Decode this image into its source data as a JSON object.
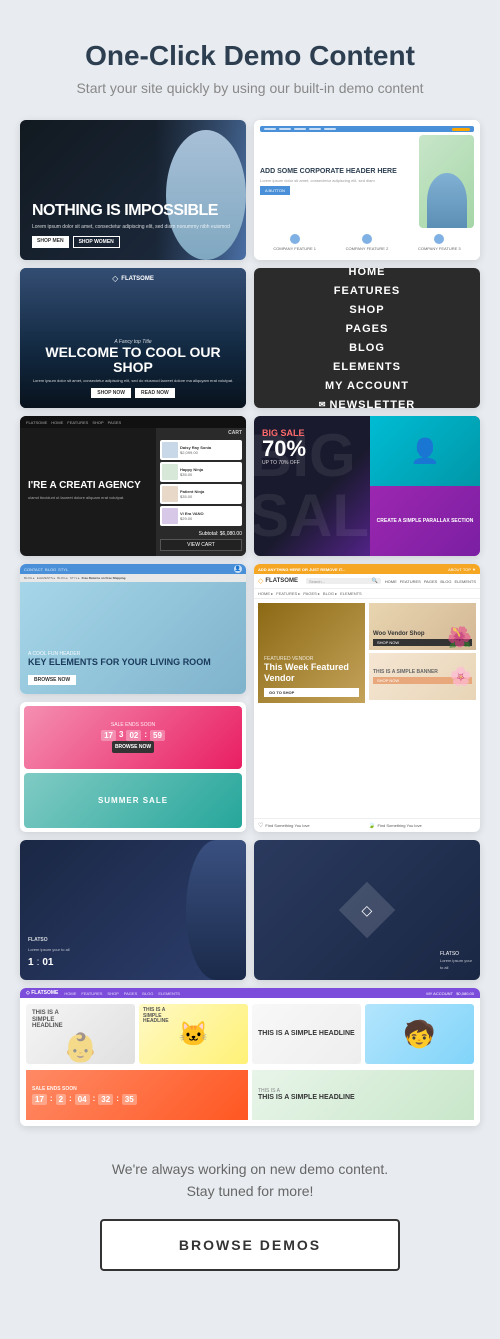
{
  "header": {
    "title": "One-Click Demo Content",
    "subtitle": "Start your site quickly by using our built-in demo content"
  },
  "demos": {
    "card_nothing": {
      "title": "NOTHING IS IMPOSSIBLE",
      "body": "Lorem ipsum dolor sit amet, consectetur adipiscing elit, sed diam nonummy nibh euismod",
      "btn1": "SHOP MEN",
      "btn2": "SHOP WOMEN"
    },
    "card_corporate": {
      "headline": "ADD SOME CORPORATE HEADER HERE",
      "body": "Lorem ipsum dolor sit amet, consectetur adipiscing elit, sed diam",
      "btn": "A BUTTON",
      "feature1": "COMPANY FEATURE 1",
      "feature2": "COMPANY FEATURE 2",
      "feature3": "COMPANY FEATURE 3"
    },
    "card_shop": {
      "subtitle": "A Fancy top Title",
      "title": "WELCOME TO COOL OUR SHOP",
      "body": "Lorem ipsum dolor sit amet, consectetur adipiscing elit, sed do eiusmod laoreet dolore ma aliquyam erat volutpat.",
      "btn1": "SHOP NOW",
      "btn2": "READ NOW"
    },
    "card_menu": {
      "items": [
        "HOME",
        "FEATURES",
        "SHOP",
        "PAGES",
        "BLOG",
        "ELEMENTS",
        "MY ACCOUNT",
        "☎ NEWSLETTER"
      ]
    },
    "card_agency": {
      "title": "I'RE A CREATI AGENCY",
      "body": "ulamd tincidunt ut laoreet dolore aliquam erat volutpat.",
      "cart_header": "CART",
      "cart_items": [
        {
          "name": "Daisy Ray Sonia Sonia Ryker",
          "price": "$2,099.00"
        },
        {
          "name": "Happy Ninja",
          "price": "$35.00"
        },
        {
          "name": "Patient Ninja",
          "price": "$35.00"
        },
        {
          "name": "Vi Era VANO",
          "price": "$29.00"
        }
      ],
      "subtotal": "Subtotal: $6,080.00",
      "cart_btn": "VIEW CART"
    },
    "card_sale": {
      "label": "BIG SALE",
      "percent": "UP TO 70% OFF",
      "create": "CREATE A SIMPLE PARALLAX SECTION"
    },
    "card_living": {
      "subtitle": "A cool fun header",
      "title": "KEY ELEMENTS FOR YOUR LIVING ROOM",
      "btn": "BROWSE NOW"
    },
    "card_summer": {
      "label": "SALE ENDS SOON",
      "countdown": [
        "17",
        "3",
        "02",
        "59"
      ],
      "btn": "BROWSE NOW",
      "bottom": "SUMMER SALE"
    },
    "card_vendor": {
      "logo": "FLATSOME",
      "featured_label": "FEATURED VENDOR",
      "featured_title": "This Week Featured Vendor",
      "featured_btn": "GO TO SHOP",
      "woo_title": "Woo Vendor Shop",
      "woo_btn": "SHOP NOW",
      "simple_label": "This is a simple banner",
      "simple_btn": "SHOP NOW",
      "find1": "Find Something You love",
      "find2": "Find Something You love"
    },
    "card_bl": {
      "logo": "FLATSO",
      "text": "Lorem ipsum   your  to all",
      "count1": "1",
      "count2": "01"
    },
    "showcase": {
      "nav_logo": "FLATSOME",
      "nav_items": [
        "HOME",
        "FEATURES",
        "SHOP",
        "PAGES",
        "BLOG",
        "ELEMENTS"
      ],
      "nav_right": "MY ACCOUNT   $0,080.00",
      "headline1": "THIS IS A SIMPLE HEADLINE",
      "headline2": "THIS IS A SIMPLE HEADLINE",
      "sale_label": "SALE ENDS SOON",
      "sale_countdown": [
        "17",
        "2",
        "04",
        "32",
        "35"
      ]
    }
  },
  "footer": {
    "text": "We're always working on new demo content.\nStay tuned for more!",
    "btn": "BROWSE DEMOS"
  }
}
